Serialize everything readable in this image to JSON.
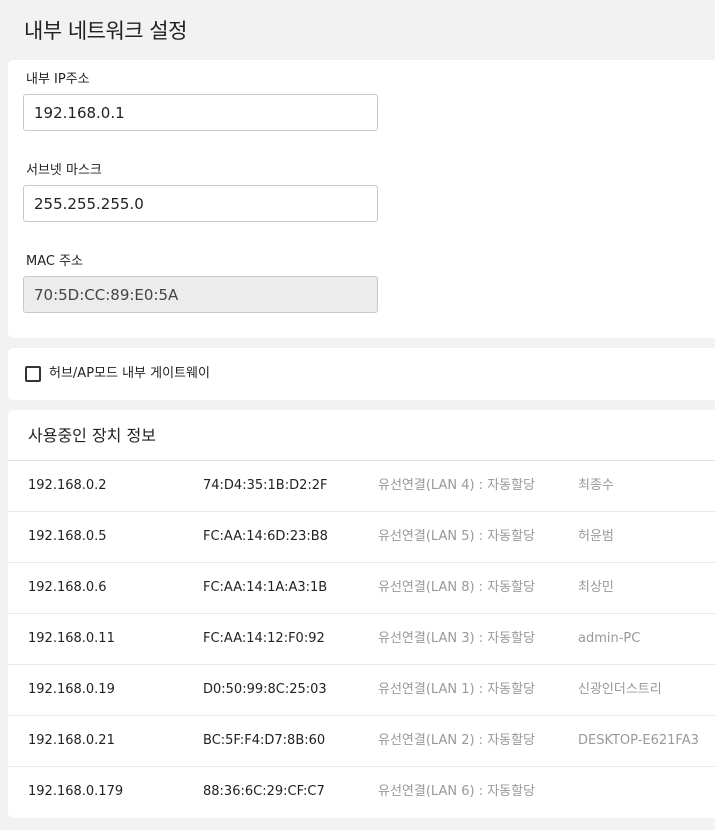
{
  "page": {
    "title": "내부 네트워크 설정"
  },
  "network": {
    "ip_label": "내부 IP주소",
    "ip_value": "192.168.0.1",
    "subnet_label": "서브넷 마스크",
    "subnet_value": "255.255.255.0",
    "mac_label": "MAC 주소",
    "mac_value": "70:5D:CC:89:E0:5A"
  },
  "gateway": {
    "checkbox_label": "허브/AP모드 내부 게이트웨이",
    "checked": false
  },
  "devices": {
    "title": "사용중인 장치 정보",
    "rows": [
      {
        "ip": "192.168.0.2",
        "mac": "74:D4:35:1B:D2:2F",
        "connection": "유선연결(LAN 4) : 자동할당",
        "name": "최종수"
      },
      {
        "ip": "192.168.0.5",
        "mac": "FC:AA:14:6D:23:B8",
        "connection": "유선연결(LAN 5) : 자동할당",
        "name": "허윤범"
      },
      {
        "ip": "192.168.0.6",
        "mac": "FC:AA:14:1A:A3:1B",
        "connection": "유선연결(LAN 8) : 자동할당",
        "name": "최상민"
      },
      {
        "ip": "192.168.0.11",
        "mac": "FC:AA:14:12:F0:92",
        "connection": "유선연결(LAN 3) : 자동할당",
        "name": "admin-PC"
      },
      {
        "ip": "192.168.0.19",
        "mac": "D0:50:99:8C:25:03",
        "connection": "유선연결(LAN 1) : 자동할당",
        "name": "신광인더스트리"
      },
      {
        "ip": "192.168.0.21",
        "mac": "BC:5F:F4:D7:8B:60",
        "connection": "유선연결(LAN 2) : 자동할당",
        "name": "DESKTOP-E621FA3"
      },
      {
        "ip": "192.168.0.179",
        "mac": "88:36:6C:29:CF:C7",
        "connection": "유선연결(LAN 6) : 자동할당",
        "name": ""
      }
    ]
  }
}
